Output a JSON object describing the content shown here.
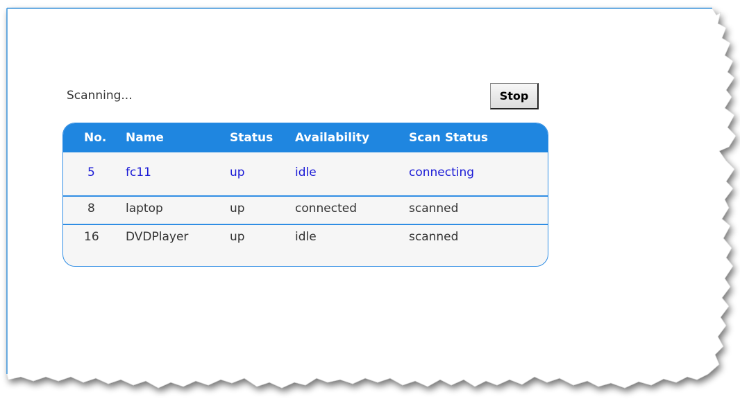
{
  "status_text": "Scanning...",
  "stop_label": "Stop",
  "table": {
    "headers": [
      "No.",
      "Name",
      "Status",
      "Availability",
      "Scan Status"
    ],
    "rows": [
      [
        "5",
        "fc11",
        "up",
        "idle",
        "connecting"
      ],
      [
        "8",
        "laptop",
        "up",
        "connected",
        "scanned"
      ],
      [
        "16",
        "DVDPlayer",
        "up",
        "idle",
        "scanned"
      ]
    ]
  },
  "colors": {
    "header_blue": "#1f86e0",
    "border_blue": "#2f8de4",
    "active_row_text": "#1a1ad6",
    "row_text": "#333333"
  }
}
